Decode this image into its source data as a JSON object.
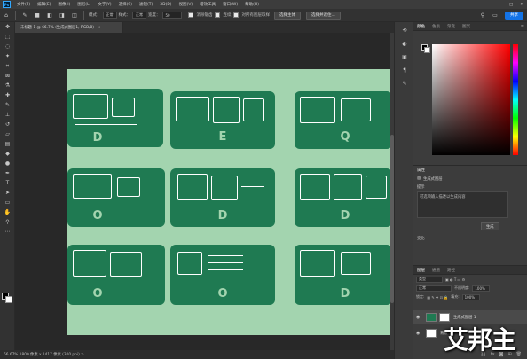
{
  "menubar": {
    "logo": "Ps",
    "items": [
      "文件(F)",
      "编辑(E)",
      "图像(I)",
      "图层(L)",
      "文字(Y)",
      "选择(S)",
      "滤镜(T)",
      "3D(D)",
      "视图(V)",
      "增效工具",
      "窗口(W)",
      "帮助(H)"
    ]
  },
  "options": {
    "home_icon": "home-icon",
    "tool_icon": "brush-icon",
    "mode_label": "模式：",
    "mode_value": "正常",
    "feather_label": "羽化：",
    "feather_value": "0 像素",
    "antialias_label": "消除锯齿",
    "style_label": "样式：",
    "style_value": "正常",
    "width_label": "宽度：",
    "width_value": "50",
    "height_label": "高度：",
    "contiguous_label": "连续",
    "sample_all_label": "对所有图层取样",
    "select_subject": "选择主体",
    "select_mask": "选择并遮住...",
    "share_label": "共享"
  },
  "doc_tab": {
    "title": "未标题-1 @ 66.7% (生成式图层1, RGB/8)",
    "close": "×"
  },
  "tiles": [
    {
      "label": "D"
    },
    {
      "label": "E"
    },
    {
      "label": "Q"
    },
    {
      "label": "O"
    },
    {
      "label": "D"
    },
    {
      "label": "D"
    },
    {
      "label": "O"
    },
    {
      "label": "O"
    },
    {
      "label": "D"
    }
  ],
  "status": {
    "text": "66.67%    1800 像素 x 1417 像素 (300 ppi)    >"
  },
  "right_panel": {
    "tabs": [
      "颜色",
      "色板",
      "渐变",
      "图案"
    ],
    "menu": "≡",
    "props_title": "属性",
    "props_layer_label": "生成式图层",
    "props_prompt_label": "提示",
    "props_prompt_text": "□ 精彩生成",
    "props_box_text": "可选项输入描述以生成内容",
    "generate_button": "生成",
    "variations_label": "变化",
    "layers_tabs": [
      "图层",
      "通道",
      "路径"
    ],
    "kind_label": "类型",
    "blend_value": "正常",
    "opacity_label": "不透明度:",
    "opacity_value": "100%",
    "lock_label": "锁定:",
    "fill_label": "填充:",
    "fill_value": "100%",
    "layers": [
      {
        "name": "生成式图层 1",
        "selected": true
      },
      {
        "name": "背景",
        "selected": false
      }
    ]
  },
  "watermark": "艾邦主",
  "colors": {
    "artboard_bg": "#a3d4af",
    "tile_green": "#1f7a52",
    "accent_blue": "#1473e6"
  }
}
